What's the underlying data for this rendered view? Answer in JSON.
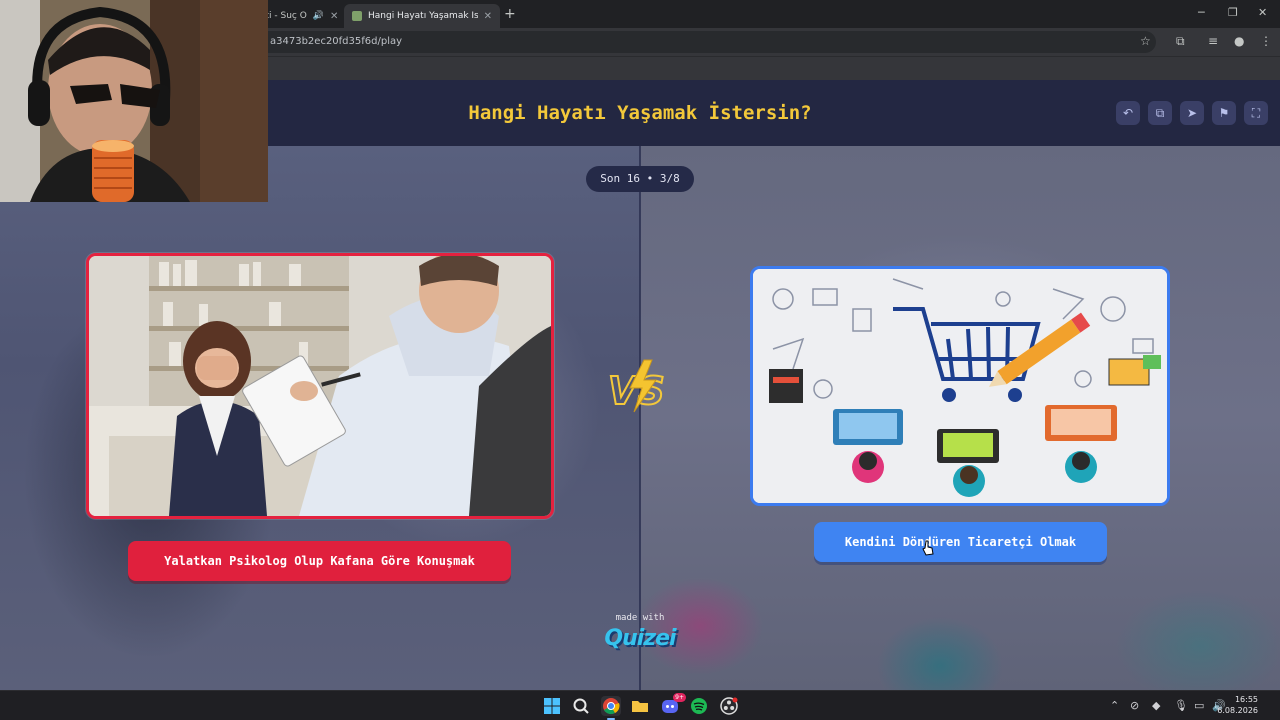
{
  "browser": {
    "tabs": [
      {
        "label": "ati - Suç O",
        "active": false
      },
      {
        "label": "Hangi Hayatı Yaşamak İstersin?",
        "active": true
      }
    ],
    "new_tab": "+",
    "url": "a3473b2ec20fd35f6d/play",
    "window_controls": {
      "minimize": "─",
      "restore": "❐",
      "close": "✕"
    }
  },
  "quiz": {
    "title": "Hangi Hayatı Yaşamak İstersin?",
    "round": "Son 16 • 3/8",
    "vs": "VS",
    "left_option": {
      "label": "Yalatkan Psikolog Olup Kafana Göre Konuşmak",
      "image": "therapy-session-photo"
    },
    "right_option": {
      "label": "Kendini Döndüren Ticaretçi Olmak",
      "image": "ecommerce-doodle-illustration"
    },
    "header_icons": [
      "undo-icon",
      "share-icon",
      "send-icon",
      "flag-icon",
      "fullscreen-icon"
    ],
    "footer": {
      "made_with": "made with",
      "brand": "Quizei"
    }
  },
  "colors": {
    "header_bg": "#232742",
    "title": "#f3c83a",
    "left_accent": "#e0203d",
    "right_accent": "#3f84f2",
    "brand": "#36c3ee"
  },
  "taskbar": {
    "apps": [
      "windows-start-icon",
      "search-icon",
      "chrome-icon",
      "file-explorer-icon",
      "discord-icon",
      "spotify-icon",
      "obs-icon"
    ],
    "discord_badge": "9+",
    "time": "16:55",
    "date": "6.08.2026"
  }
}
